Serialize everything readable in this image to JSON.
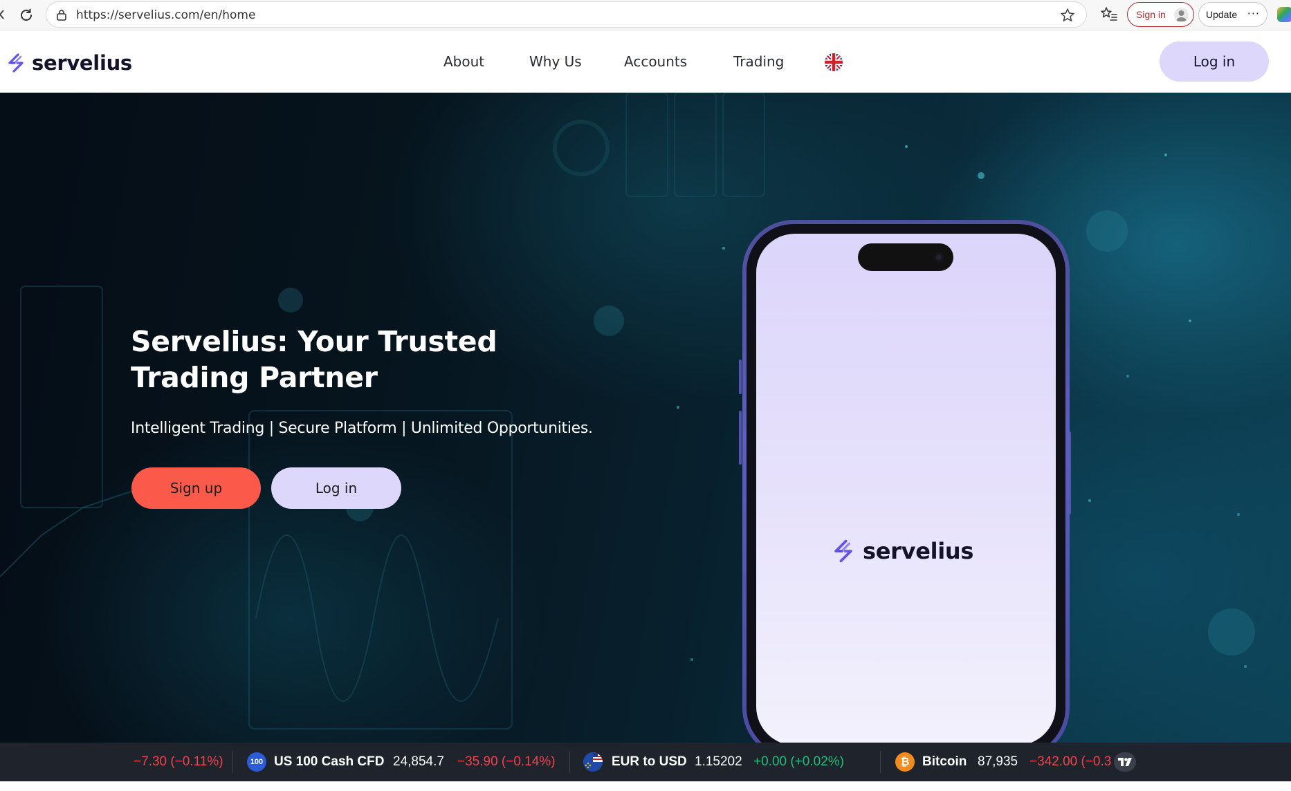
{
  "browser": {
    "url": "https://servelius.com/en/home",
    "sign_in_label": "Sign in",
    "update_label": "Update",
    "more_glyph": "···"
  },
  "header": {
    "brand": "servelius",
    "nav": [
      "About",
      "Why Us",
      "Accounts",
      "Trading"
    ],
    "language_icon": "uk-flag-icon",
    "login_label": "Log in"
  },
  "hero": {
    "title": "Servelius: Your Trusted Trading Partner",
    "subtitle": "Intelligent Trading | Secure Platform | Unlimited Opportunities.",
    "signup_label": "Sign up",
    "login_label": "Log in",
    "phone_brand": "servelius"
  },
  "ticker": {
    "items": [
      {
        "name": "",
        "price": "",
        "change": "−7.30 (−0.11%)",
        "direction": "down"
      },
      {
        "icon_text": "100",
        "name": "US 100 Cash CFD",
        "price": "24,854.7",
        "change": "−35.90 (−0.14%)",
        "direction": "down"
      },
      {
        "icon": "eur-usd-flags-icon",
        "name": "EUR to USD",
        "price": "1.15202",
        "change": "+0.00 (+0.02%)",
        "direction": "up"
      },
      {
        "icon": "bitcoin-icon",
        "name": "Bitcoin",
        "price": "87,935",
        "change": "−342.00 (−0.3",
        "direction": "down"
      }
    ],
    "provider_icon": "tradingview-icon"
  },
  "colors": {
    "brand_purple": "#5b4fe6",
    "accent_coral": "#fb5a4a",
    "lavender": "#ddd8fb",
    "ticker_negative": "#f2434b",
    "ticker_positive": "#1fbf7a"
  }
}
